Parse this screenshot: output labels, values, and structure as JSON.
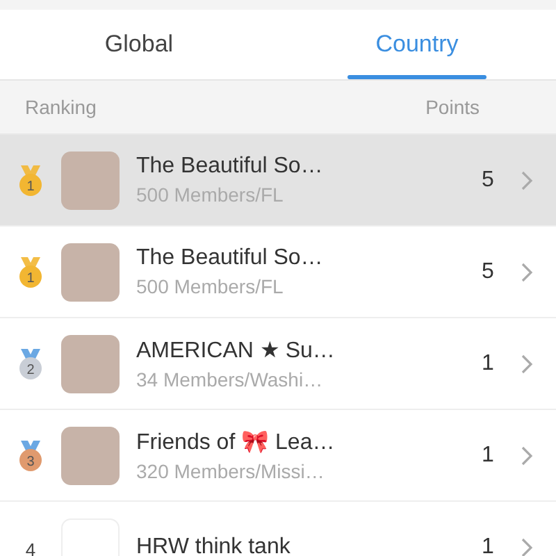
{
  "tabs": [
    {
      "label": "Global",
      "selected": false
    },
    {
      "label": "Country",
      "selected": true
    }
  ],
  "table": {
    "columns": [
      "Ranking",
      "Points"
    ],
    "rows": [
      {
        "rank": "1",
        "kind": "medal",
        "color": "#f2b632",
        "name": "The Beautiful So…",
        "members": "500 Members/FL",
        "points": "5",
        "selected": true
      },
      {
        "rank": "1",
        "kind": "medal",
        "color": "#f2b632",
        "name": "The Beautiful So…",
        "members": "500 Members/FL",
        "points": "5",
        "selected": false
      },
      {
        "rank": "2",
        "kind": "medal",
        "color": "#c9ced6",
        "name": "AMERICAN ★ Su…",
        "members": "34 Members/Washi…",
        "points": "1",
        "selected": false
      },
      {
        "rank": "3",
        "kind": "medal",
        "color": "#e09a6e",
        "name": "Friends of 🎀 Lea…",
        "members": "320 Members/Missi…",
        "points": "1",
        "selected": false
      },
      {
        "rank": "4",
        "kind": "plain",
        "name": "HRW think tank",
        "points": "1",
        "selected": false
      }
    ]
  }
}
